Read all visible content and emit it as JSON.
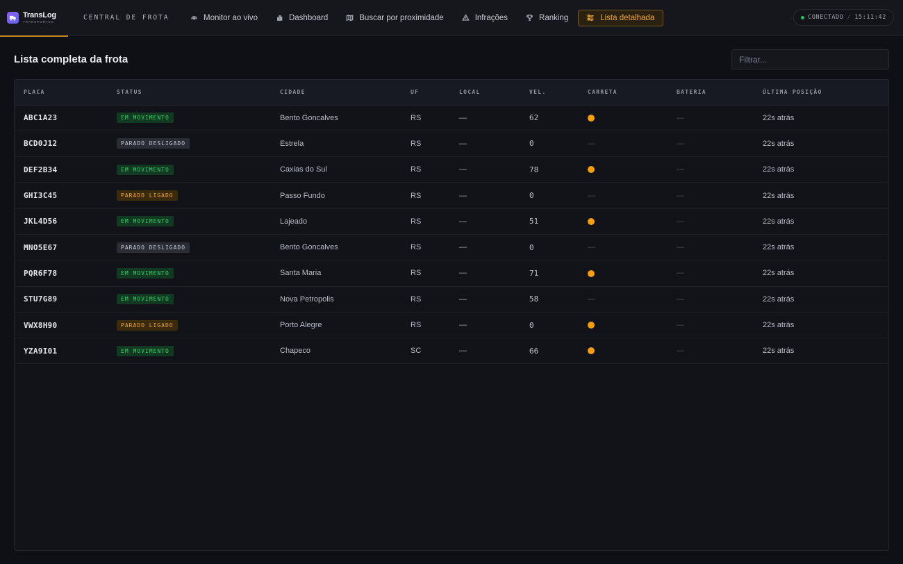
{
  "brand": {
    "name": "TransLog",
    "sub": "TRANSPORTES"
  },
  "header": {
    "section": "CENTRAL DE FROTA",
    "nav": [
      {
        "label": "Monitor ao vivo",
        "icon": "radar-icon"
      },
      {
        "label": "Dashboard",
        "icon": "bar-chart-icon"
      },
      {
        "label": "Buscar por proximidade",
        "icon": "map-icon"
      },
      {
        "label": "Infrações",
        "icon": "warning-icon"
      },
      {
        "label": "Ranking",
        "icon": "trophy-icon"
      },
      {
        "label": "Lista detalhada",
        "icon": "list-icon",
        "active": true
      }
    ],
    "status": {
      "label": "CONECTADO",
      "time": "15:11:42",
      "color": "#22c55e"
    }
  },
  "main": {
    "title": "Lista completa da frota",
    "filter_placeholder": "Filtrar...",
    "columns": [
      "PLACA",
      "STATUS",
      "CIDADE",
      "UF",
      "LOCAL",
      "VEL.",
      "CARRETA",
      "BATERIA",
      "ÚLTIMA POSIÇÃO"
    ],
    "rows": [
      {
        "placa": "ABC1A23",
        "status": "EM MOVIMENTO",
        "status_type": "mov",
        "cidade": "Bento Goncalves",
        "uf": "RS",
        "local": "—",
        "vel": "62",
        "carreta": true,
        "bateria": "—",
        "ultima": "22s atrás"
      },
      {
        "placa": "BCD0J12",
        "status": "PARADO DESLIGADO",
        "status_type": "desl",
        "cidade": "Estrela",
        "uf": "RS",
        "local": "—",
        "vel": "0",
        "carreta": false,
        "bateria": "—",
        "ultima": "22s atrás"
      },
      {
        "placa": "DEF2B34",
        "status": "EM MOVIMENTO",
        "status_type": "mov",
        "cidade": "Caxias do Sul",
        "uf": "RS",
        "local": "—",
        "vel": "78",
        "carreta": true,
        "bateria": "—",
        "ultima": "22s atrás"
      },
      {
        "placa": "GHI3C45",
        "status": "PARADO LIGADO",
        "status_type": "lig",
        "cidade": "Passo Fundo",
        "uf": "RS",
        "local": "—",
        "vel": "0",
        "carreta": false,
        "bateria": "—",
        "ultima": "22s atrás"
      },
      {
        "placa": "JKL4D56",
        "status": "EM MOVIMENTO",
        "status_type": "mov",
        "cidade": "Lajeado",
        "uf": "RS",
        "local": "—",
        "vel": "51",
        "carreta": true,
        "bateria": "—",
        "ultima": "22s atrás"
      },
      {
        "placa": "MNO5E67",
        "status": "PARADO DESLIGADO",
        "status_type": "desl",
        "cidade": "Bento Goncalves",
        "uf": "RS",
        "local": "—",
        "vel": "0",
        "carreta": false,
        "bateria": "—",
        "ultima": "22s atrás"
      },
      {
        "placa": "PQR6F78",
        "status": "EM MOVIMENTO",
        "status_type": "mov",
        "cidade": "Santa Maria",
        "uf": "RS",
        "local": "—",
        "vel": "71",
        "carreta": true,
        "bateria": "—",
        "ultima": "22s atrás"
      },
      {
        "placa": "STU7G89",
        "status": "EM MOVIMENTO",
        "status_type": "mov",
        "cidade": "Nova Petropolis",
        "uf": "RS",
        "local": "—",
        "vel": "58",
        "carreta": false,
        "bateria": "—",
        "ultima": "22s atrás"
      },
      {
        "placa": "VWX8H90",
        "status": "PARADO LIGADO",
        "status_type": "lig",
        "cidade": "Porto Alegre",
        "uf": "RS",
        "local": "—",
        "vel": "0",
        "carreta": true,
        "bateria": "—",
        "ultima": "22s atrás"
      },
      {
        "placa": "YZA9I01",
        "status": "EM MOVIMENTO",
        "status_type": "mov",
        "cidade": "Chapeco",
        "uf": "SC",
        "local": "—",
        "vel": "66",
        "carreta": true,
        "bateria": "—",
        "ultima": "22s atrás"
      }
    ],
    "empty_cell": "—",
    "colors": {
      "moving": "#34d068",
      "idle_on": "#f0a93a",
      "trailer_dot": "#f59e0b"
    }
  }
}
